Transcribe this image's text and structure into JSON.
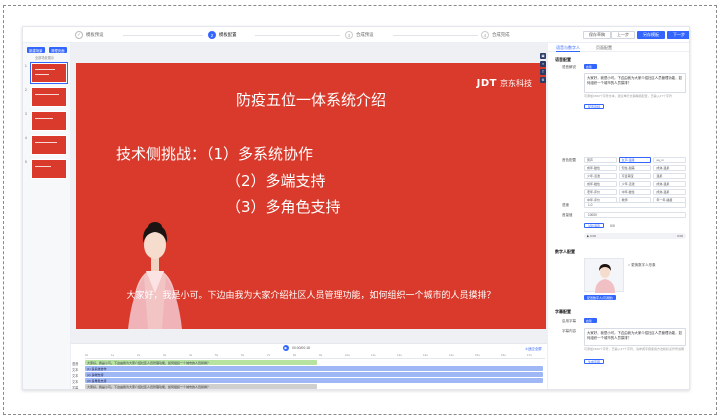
{
  "topbar": {
    "steps": [
      {
        "num": "✓",
        "label": "模板预设",
        "state": "done"
      },
      {
        "num": "2",
        "label": "模板配置",
        "state": "active"
      },
      {
        "num": "3",
        "label": "合成预设",
        "state": "todo"
      },
      {
        "num": "4",
        "label": "合成完成",
        "state": "todo"
      }
    ],
    "buttons": {
      "save": "保存草稿",
      "prev": "上一步",
      "save_template": "另存模板",
      "next": "下一步"
    }
  },
  "left": {
    "btn_a": "新建场景",
    "btn_b": "清理页面",
    "hint": "全部场景展示",
    "thumbs": [
      "1",
      "2",
      "3",
      "4",
      "5"
    ]
  },
  "slide": {
    "title": "防疫五位一体系统介绍",
    "logo_mark": "JDT",
    "logo_text": "京东科技",
    "point_1": "技术侧挑战：（1）多系统协作",
    "point_2": "（2）多端支持",
    "point_3": "（3）多角色支持",
    "subtitle": "大家好，我是小可。下边由我为大家介绍社区人员管理功能，如何组织一个城市的人员摸排？"
  },
  "timeline": {
    "play_icon": "play-icon",
    "time": "00:00/00:18",
    "zoom": "①适应全屏",
    "ticks": [
      "0s",
      "1s",
      "2s",
      "3s",
      "4s",
      "5s",
      "6s",
      "7s",
      "8s",
      "9s",
      "10s",
      "11s",
      "12s",
      "13s",
      "14s",
      "15s",
      "16s",
      "17s"
    ],
    "track_labels": [
      "语音",
      "文本",
      "文本",
      "文本",
      "字幕"
    ],
    "tracks": [
      "大家好，我是小可。下边由我为大家介绍社区人员管理功能，如何组织一个城市的人员摸排？",
      "(1) 多系统协作",
      "(2) 多端支持",
      "(3) 多角色支持",
      "大家好，我是小可。下边由我为大家介绍社区人员管理功能，如何组织一个城市的人员摸排？"
    ]
  },
  "right": {
    "tab_1": "语音与数字人",
    "tab_2": "页面配置",
    "voice_section": "语音配置",
    "voice_toggle_label": "语音解说",
    "toggle_on": "启用",
    "script": "大家好，我是小可。下边由我为大家介绍社区人员管理功能，如何组织一个城市的人员摸排？",
    "script_hint": "可添加1500个字符文本，建议单行文稿精简配置，已输入47个字符",
    "generate_btn": "配置音频",
    "voice_label": "音色配置",
    "voices": [
      "男声",
      "女声-温柔",
      "sq_m",
      "成年-磁性",
      "知性-甜美",
      "成熟-温柔",
      "少年-活泼",
      "可爱萌宝",
      "温柔",
      "成年-磁性",
      "少年-活泼",
      "成熟-温柔",
      "老年-评价",
      "中年-磁性",
      "成熟-温柔",
      "中年-评价",
      "教师",
      "年一年-播报"
    ],
    "speed_label": "语速",
    "speed_value": "1.0",
    "volume_label": "音量值",
    "volume_value": "10000",
    "audition_btn": "试听语音",
    "audition_extra": "0/0",
    "audio_time_start": "0:00",
    "audio_time_end": "0:00",
    "avatar_section": "数字人配置",
    "avatar_option": "更换数字人形象",
    "avatar_btn": "配置数字人(可调整)",
    "subtitle_section": "字幕配置",
    "subtitle_toggle_label": "启用字幕",
    "subtitle_content_label": "字幕内容",
    "subtitle_text": "大家好，我是小可。下边由我为大家介绍社区人员管理功能，如何组织一个城市的人员摸排？",
    "subtitle_hint": "可添加1500个字符，已输入47个字符，请参阅字幕使用方法和标点符号说明",
    "subtitle_btn": "生成字幕"
  },
  "icons": [
    "image-icon",
    "layers-icon",
    "text-icon",
    "settings-icon"
  ]
}
